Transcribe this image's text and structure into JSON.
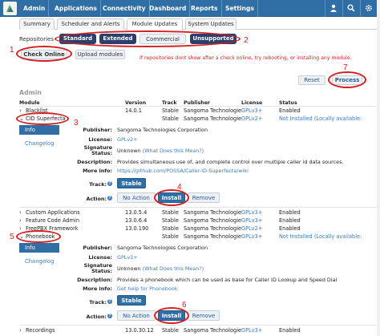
{
  "nav": {
    "items": [
      "Admin",
      "Applications",
      "Connectivity",
      "Dashboard",
      "Reports",
      "Settings"
    ],
    "icons": [
      "user-icon",
      "search-icon",
      "gear-icon"
    ]
  },
  "tabs": [
    "Summary",
    "Scheduler and Alerts",
    "Module Updates",
    "System Updates"
  ],
  "repositories": {
    "label": "Repositories",
    "items": [
      "Standard",
      "Extended",
      "Commercial",
      "Unsupported"
    ]
  },
  "actions": {
    "check_online": "Check Online",
    "upload_modules": "Upload modules",
    "warning": "If repositories dont show after a check online, try rebooting, or installing any module.",
    "reset": "Reset",
    "process": "Process"
  },
  "section_title": "Admin",
  "table": {
    "headers": [
      "Module",
      "Version",
      "Track",
      "Publisher",
      "License",
      "Status"
    ]
  },
  "modules": {
    "blacklist": {
      "name": "Blacklist",
      "version": "14.0.1",
      "track": "Stable",
      "publisher": "Sangoma Technologie",
      "license": "GPLv3+",
      "status": "Enabled"
    },
    "cid": {
      "name": "CID Superfecta",
      "track": "Stable",
      "publisher": "Sangoma Technologie",
      "license": "GPLv2+",
      "status": "Not Installed (Locally available:"
    },
    "custom_apps": {
      "name": "Custom Applications",
      "version": "13.0.5.4",
      "track": "Stable",
      "publisher": "Sangoma Technologie",
      "license": "GPLv3+",
      "status": "Enabled"
    },
    "feature_codes": {
      "name": "Feature Code Admin",
      "version": "13.0.6.4",
      "track": "Stable",
      "publisher": "Sangoma Technologie",
      "license": "GPLv3+",
      "status": "Enabled"
    },
    "freepbx": {
      "name": "FreePBX Framework",
      "version": "13.0.190",
      "track": "Stable",
      "publisher": "Sangoma Technologie",
      "license": "GPLv2+",
      "status": "Enabled"
    },
    "phonebook": {
      "name": "Phonebook",
      "track": "Stable",
      "publisher": "Sangoma Technologie",
      "license": "GPLv3+",
      "status": "Not Installed (Locally available:"
    },
    "recordings": {
      "name": "Recordings",
      "version": "13.0.30.12",
      "track": "Stable",
      "publisher": "Sangoma Technologie",
      "license": "GPLv3+",
      "status": "Enabled"
    }
  },
  "detail_labels": {
    "publisher": "Publisher:",
    "license": "License:",
    "signature": "Signature",
    "status": "Status:",
    "description": "Description:",
    "more_info": "More info:",
    "track": "Track:",
    "action": "Action:"
  },
  "side_tabs": {
    "info": "Info",
    "changelog": "Changelog"
  },
  "cid_detail": {
    "publisher": "Sangoma Technologies Corporation",
    "license": "GPLv2+",
    "signature": "Unknown",
    "signature_link": "(What Does this Mean?)",
    "description": "Provides simultaneous use of, and complete control over multiple caller id data sources.",
    "more_info": "https://github.com/POSSA/Caller-ID-Superfecta/wiki",
    "track": "Stable",
    "no_action": "No Action",
    "install": "Install",
    "remove": "Remove"
  },
  "phonebook_detail": {
    "publisher": "Sangoma Technologies Corporation",
    "license": "GPLv3+",
    "signature": "Unknown",
    "signature_link": "(What Does this Mean?)",
    "description": "Provides a phonebook which can be used as base for Caller ID Lookup and Speed Dial",
    "more_info": "Get help for Phonebook",
    "track": "Stable",
    "no_action": "No Action",
    "install": "Install",
    "remove": "Remove"
  },
  "annotations": [
    "1",
    "2",
    "3",
    "4",
    "5",
    "6",
    "7"
  ],
  "colors": {
    "accent": "#2f6fa5",
    "pill_dark": "#2a3f6b",
    "annotation": "#d42020",
    "link": "#3b7bbf"
  }
}
